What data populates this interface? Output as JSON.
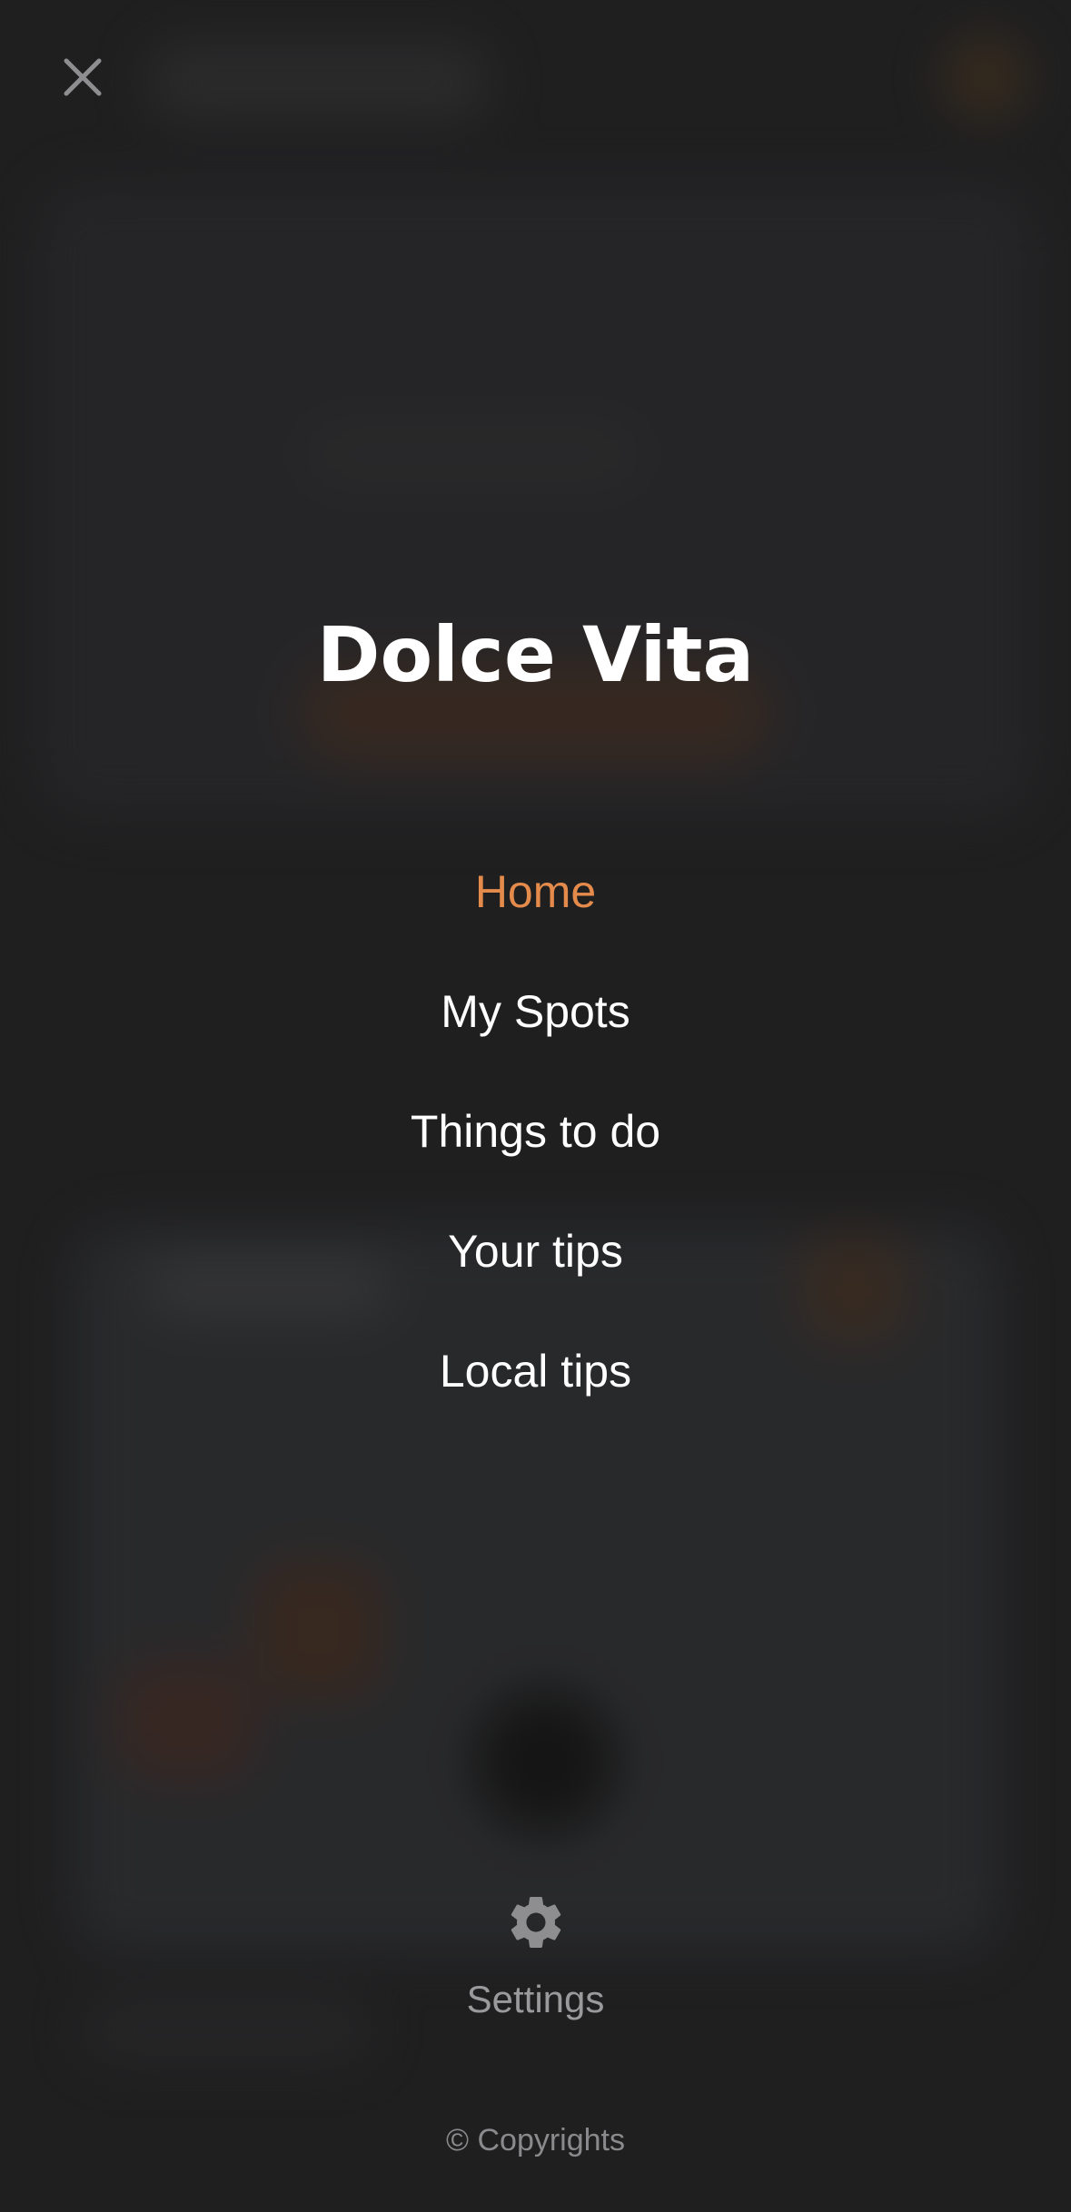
{
  "app": {
    "title": "Dolce Vita"
  },
  "header": {
    "close_icon": "close-icon"
  },
  "menu": {
    "items": [
      {
        "label": "Home",
        "active": true
      },
      {
        "label": "My Spots",
        "active": false
      },
      {
        "label": "Things to do",
        "active": false
      },
      {
        "label": "Your tips",
        "active": false
      },
      {
        "label": "Local tips",
        "active": false
      }
    ]
  },
  "settings": {
    "label": "Settings",
    "icon": "gear-icon"
  },
  "footer": {
    "copyright": "© Copyrights"
  },
  "colors": {
    "background": "#1f1f20",
    "accent": "#e48b4c",
    "text_primary": "#ffffff",
    "text_muted": "#9a9a9c"
  }
}
